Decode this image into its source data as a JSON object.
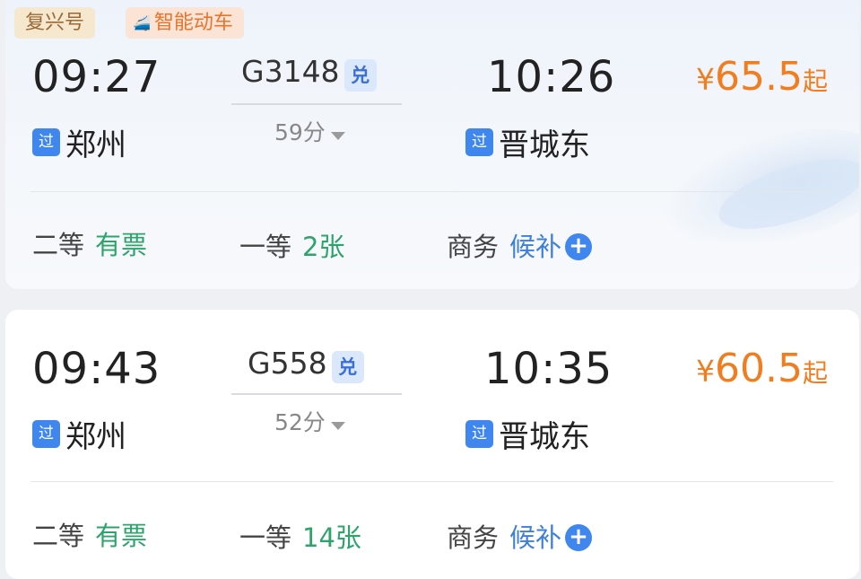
{
  "tags": {
    "fuxing": "复兴号",
    "smart": "智能动车",
    "train_icon": "train-icon"
  },
  "trains": [
    {
      "depart_time": "09:27",
      "train_number": "G3148",
      "exchange_badge": "兑",
      "duration": "59分",
      "arrive_time": "10:26",
      "pass_badge": "过",
      "from_station": "郑州",
      "to_station": "晋城东",
      "price_symbol": "¥",
      "price": "65.5",
      "price_suffix": "起",
      "seats": [
        {
          "class": "二等",
          "status": "有票"
        },
        {
          "class": "一等",
          "status": "2张"
        },
        {
          "class": "商务",
          "status": "候补"
        }
      ]
    },
    {
      "depart_time": "09:43",
      "train_number": "G558",
      "exchange_badge": "兑",
      "duration": "52分",
      "arrive_time": "10:35",
      "pass_badge": "过",
      "from_station": "郑州",
      "to_station": "晋城东",
      "price_symbol": "¥",
      "price": "60.5",
      "price_suffix": "起",
      "seats": [
        {
          "class": "二等",
          "status": "有票"
        },
        {
          "class": "一等",
          "status": "14张"
        },
        {
          "class": "商务",
          "status": "候补"
        }
      ]
    }
  ],
  "colors": {
    "price": "#f07d1f",
    "available": "#2ea36b",
    "waitlist": "#3e7fd8",
    "badge_blue": "#3f86ee"
  }
}
